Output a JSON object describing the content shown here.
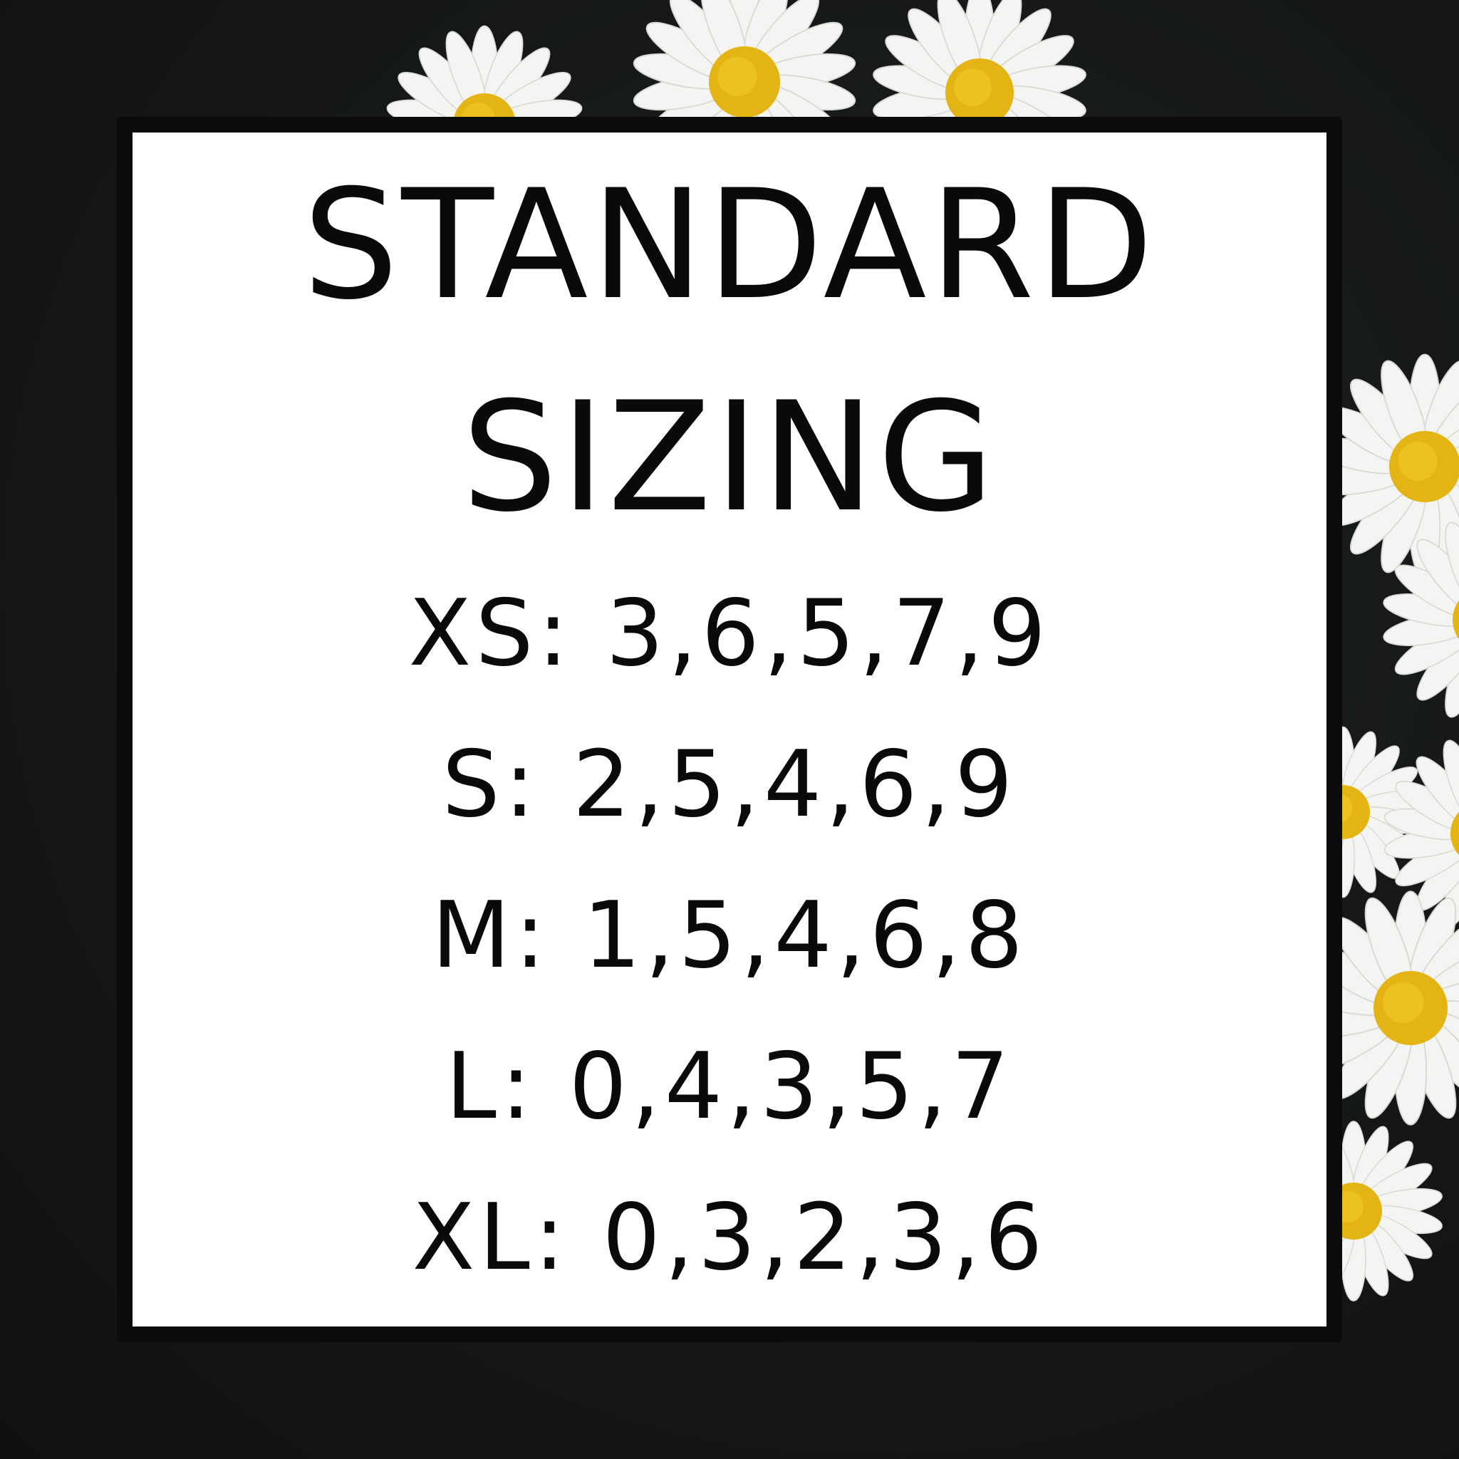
{
  "background_color": "#151817",
  "title": {
    "line1": "STANDARD",
    "line2": "SIZING"
  },
  "sizes": [
    {
      "label": "XS",
      "values": "3,6,5,7,9",
      "text": "XS: 3,6,5,7,9"
    },
    {
      "label": "S",
      "values": "2,5,4,6,9",
      "text": "S: 2,5,4,6,9"
    },
    {
      "label": "M",
      "values": "1,5,4,6,8",
      "text": "M: 1,5,4,6,8"
    },
    {
      "label": "L",
      "values": "0,4,3,5,7",
      "text": "L: 0,4,3,5,7"
    },
    {
      "label": "XL",
      "values": "0,3,2,3,6",
      "text": "XL: 0,3,2,3,6"
    }
  ],
  "decoration": {
    "petal_color": "#f4f4f2",
    "center_color": "#e4b414"
  }
}
